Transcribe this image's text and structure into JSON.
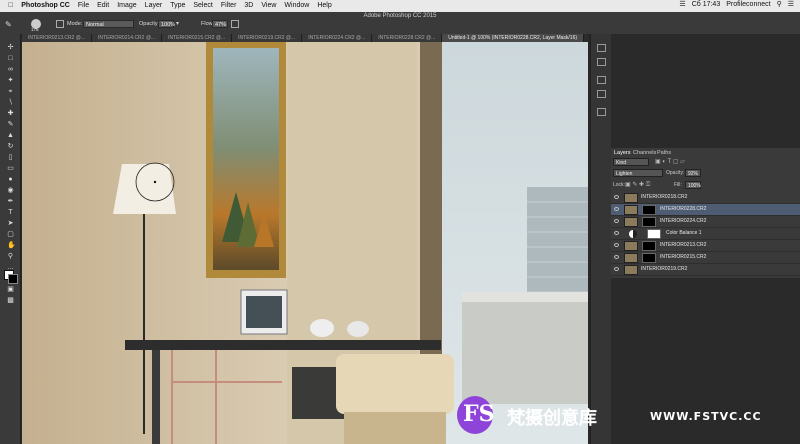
{
  "menubar": {
    "app": "Photoshop CC",
    "items": [
      "File",
      "Edit",
      "Image",
      "Layer",
      "Type",
      "Select",
      "Filter",
      "3D",
      "View",
      "Window",
      "Help"
    ],
    "clock": "Сб 17:43",
    "user": "Profileconnect"
  },
  "window": {
    "title": "Adobe Photoshop CC 2015"
  },
  "options": {
    "brush_size": "175",
    "mode_label": "Mode:",
    "mode_value": "Normal",
    "opacity_label": "Opacity:",
    "opacity_value": "100%",
    "flow_label": "Flow:",
    "flow_value": "47%"
  },
  "tabs": [
    "INTERIOR0213.CR2 @...",
    "INTERIOR0214.CR2 @...",
    "INTERIOR0215.CR2 @...",
    "INTERIOR0219.CR2 @...",
    "INTERIOR0224.CR2 @...",
    "INTERIOR0228.CR2 @...",
    "Untitled-1 @ 100% (INTERIOR0228.CR2, Layer Mask/16)"
  ],
  "layers_panel": {
    "tabs": [
      "Layers",
      "Channels",
      "Paths"
    ],
    "kind": "Kind",
    "blend_mode": "Lighten",
    "opacity_label": "Opacity:",
    "opacity_value": "92%",
    "lock_label": "Lock:",
    "fill_label": "Fill:",
    "fill_value": "100%",
    "layers": [
      {
        "name": "INTERIOR0218.CR2"
      },
      {
        "name": "INTERIOR0228.CR2"
      },
      {
        "name": "INTERIOR0224.CR2"
      },
      {
        "name": "Color Balance 1"
      },
      {
        "name": "INTERIOR0213.CR2"
      },
      {
        "name": "INTERIOR0215.CR2"
      },
      {
        "name": "INTERIOR0219.CR2"
      }
    ]
  },
  "watermark": {
    "logo": "FS",
    "text": "梵摄创意库",
    "url": "WWW.FSTVC.CC"
  }
}
